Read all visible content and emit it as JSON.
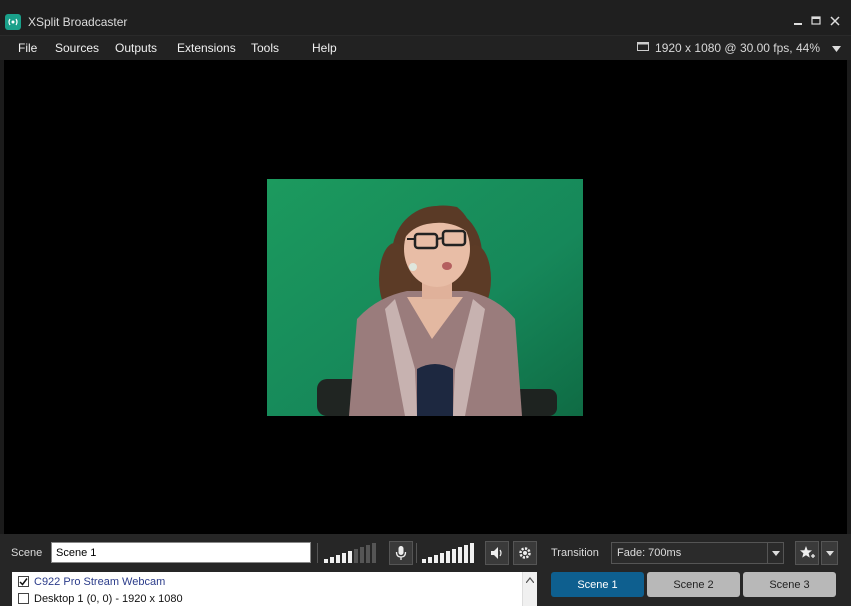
{
  "titlebar": {
    "title": "XSplit Broadcaster"
  },
  "menu": [
    "File",
    "Sources",
    "Outputs",
    "Extensions",
    "Tools",
    "Help"
  ],
  "status": {
    "resolution": "1920 x 1080 @ 30.00 fps, 44%"
  },
  "bottom": {
    "scene_label": "Scene",
    "scene_name": "Scene 1",
    "transition_label": "Transition",
    "transition_value": "Fade: 700ms"
  },
  "sources": [
    {
      "label": "C922 Pro Stream Webcam",
      "checked": true
    },
    {
      "label": "Desktop 1 (0, 0) - 1920 x 1080",
      "checked": false
    }
  ],
  "scenes": [
    {
      "label": "Scene 1",
      "active": true
    },
    {
      "label": "Scene 2",
      "active": false
    },
    {
      "label": "Scene 3",
      "active": false
    }
  ],
  "colors": {
    "accent": "#0e5f8f",
    "brand": "#1aa08a",
    "chroma_green": "#1f9a5e"
  }
}
